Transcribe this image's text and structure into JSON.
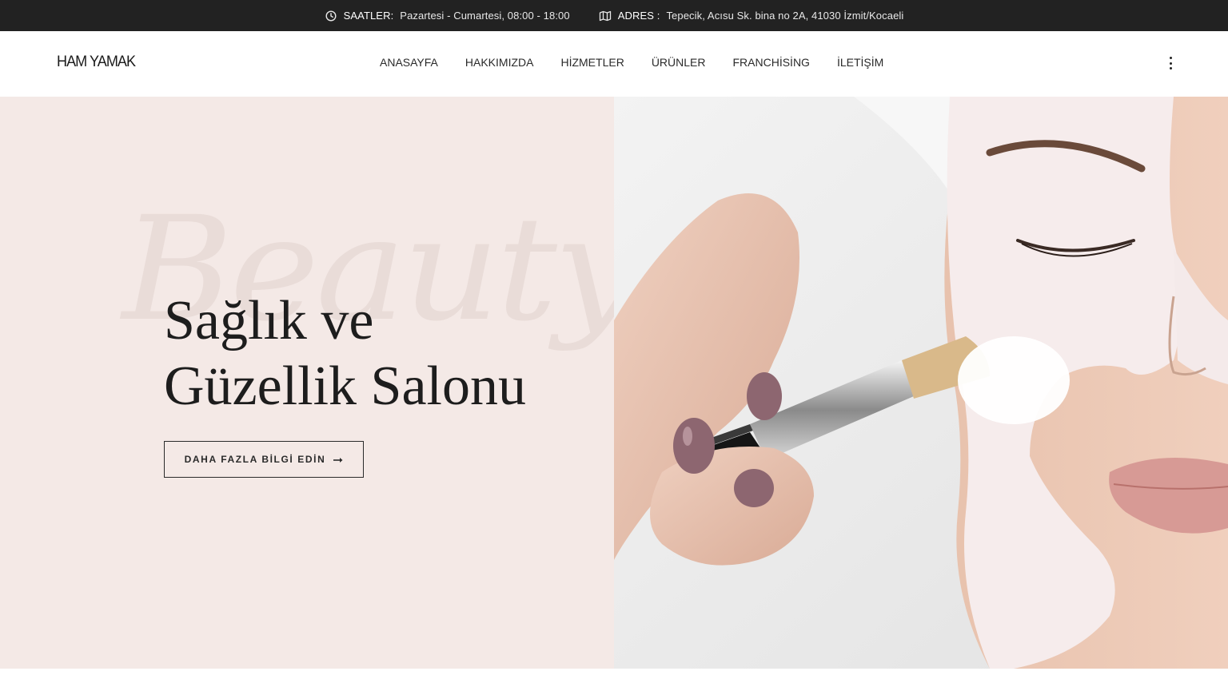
{
  "topbar": {
    "hours_label": "SAATLER:",
    "hours_value": "Pazartesi - Cumartesi, 08:00 - 18:00",
    "address_label": "ADRES :",
    "address_value": "Tepecik, Acısu Sk. bina no 2A, 41030 İzmit/Kocaeli",
    "hours_icon": "clock-icon",
    "address_icon": "map-icon"
  },
  "header": {
    "logo": "HAM YAMAK",
    "nav": [
      "ANASAYFA",
      "HAKKIMIZDA",
      "HİZMETLER",
      "ÜRÜNLER",
      "FRANCHİSİNG",
      "İLETİŞİM"
    ],
    "menu_icon": "kebab-menu-icon"
  },
  "hero": {
    "watermark": "Beauty",
    "title_line1": "Sağlık ve",
    "title_line2": "Güzellik Salonu",
    "cta_label": "DAHA FAZLA BİLGİ EDİN",
    "cta_icon": "arrow-right-icon",
    "image_alt": "face-mask-brush-photo",
    "colors": {
      "topbar_bg": "#222222",
      "hero_left_bg": "#f4e9e6",
      "text_dark": "#1d1d1d"
    }
  }
}
